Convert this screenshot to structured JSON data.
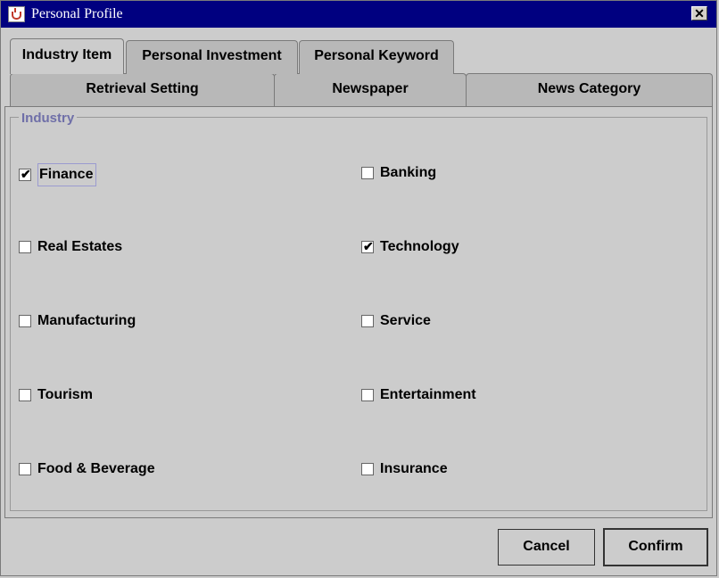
{
  "window": {
    "title": "Personal Profile",
    "close_glyph": "✕",
    "icon": "coffee-cup-icon"
  },
  "tabs": {
    "row1": [
      {
        "label": "Industry Item",
        "selected": true
      },
      {
        "label": "Personal Investment",
        "selected": false
      },
      {
        "label": "Personal Keyword",
        "selected": false
      }
    ],
    "row2": [
      {
        "label": "Retrieval Setting",
        "selected": false
      },
      {
        "label": "Newspaper",
        "selected": false
      },
      {
        "label": "News Category",
        "selected": false
      }
    ]
  },
  "industry": {
    "title": "Industry",
    "items": [
      {
        "label": "Finance",
        "checked": true
      },
      {
        "label": "Banking",
        "checked": false
      },
      {
        "label": "Real Estates",
        "checked": false
      },
      {
        "label": "Technology",
        "checked": true
      },
      {
        "label": "Manufacturing",
        "checked": false
      },
      {
        "label": "Service",
        "checked": false
      },
      {
        "label": "Tourism",
        "checked": false
      },
      {
        "label": "Entertainment",
        "checked": false
      },
      {
        "label": "Food & Beverage",
        "checked": false
      },
      {
        "label": "Insurance",
        "checked": false
      }
    ],
    "check_glyph": "✔"
  },
  "buttons": {
    "cancel": "Cancel",
    "confirm": "Confirm"
  }
}
